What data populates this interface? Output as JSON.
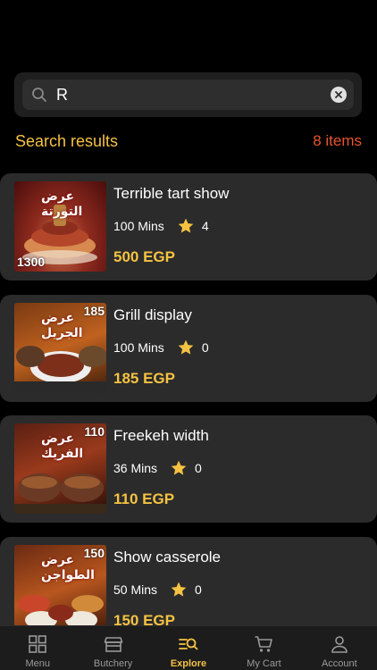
{
  "search": {
    "value": "R",
    "placeholder": ""
  },
  "results": {
    "title": "Search results",
    "count": "8 items"
  },
  "items": [
    {
      "name": "Terrible tart show",
      "time": "100 Mins",
      "rating": "4",
      "price": "500 EGP",
      "thumb_tag": "1300",
      "thumb_title": "عرض التورتة"
    },
    {
      "name": "Grill display",
      "time": "100 Mins",
      "rating": "0",
      "price": "185 EGP",
      "thumb_tag": "185",
      "thumb_title": "عرض الجريل"
    },
    {
      "name": "Freekeh width",
      "time": "36 Mins",
      "rating": "0",
      "price": "110 EGP",
      "thumb_tag": "110",
      "thumb_title": "عرض الفريك"
    },
    {
      "name": "Show casserole",
      "time": "50 Mins",
      "rating": "0",
      "price": "150 EGP",
      "thumb_tag": "150",
      "thumb_title": "عرض الطواجن"
    }
  ],
  "tabs": [
    {
      "label": "Menu",
      "icon": "grid-icon"
    },
    {
      "label": "Butchery",
      "icon": "shop-icon"
    },
    {
      "label": "Explore",
      "icon": "explore-search-icon"
    },
    {
      "label": "My Cart",
      "icon": "cart-icon"
    },
    {
      "label": "Account",
      "icon": "person-icon"
    }
  ],
  "colors": {
    "accent": "#f5c242",
    "count": "#e8552d",
    "card": "#2b2b2b",
    "background": "#000000"
  }
}
